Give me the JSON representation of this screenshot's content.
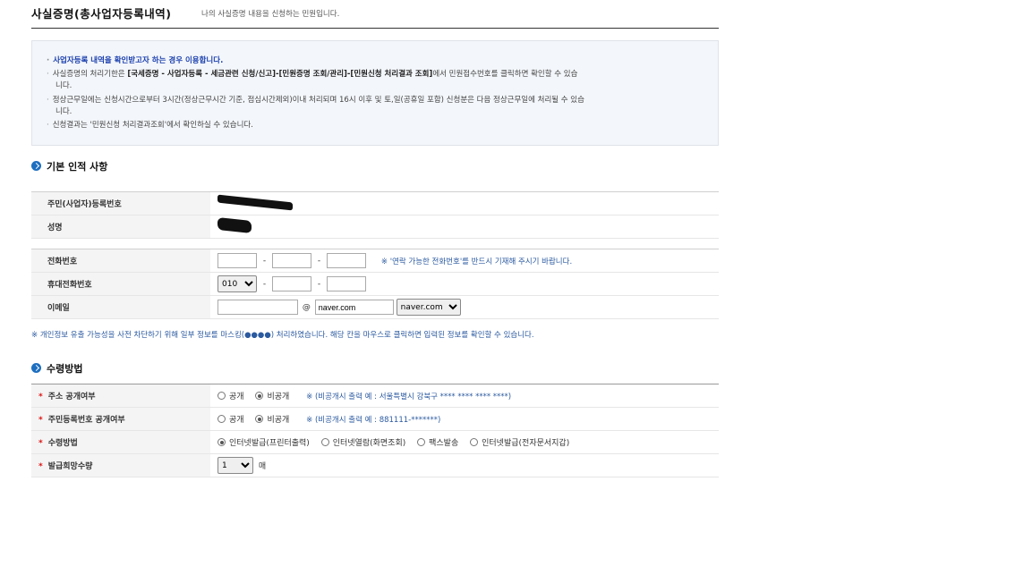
{
  "header": {
    "title": "사실증명(총사업자등록내역)",
    "subtitle": "나의 사실증명 내용을 신청하는 민원입니다."
  },
  "notice": {
    "line1": "사업자등록 내역을 확인받고자 하는 경우 이용합니다.",
    "line2_pre": "사실증명의 처리기한은 ",
    "line2_bold": "[국세증명 - 사업자등록 - 세금관련 신청/신고]-[민원증명 조회/관리]-[민원신청 처리결과 조회]",
    "line2_post": "에서 민원접수번호를 클릭하면 확인할 수 있습",
    "line2_wrap": "니다.",
    "line3": "정상근무일에는 신청시간으로부터 3시간(정상근무시간 기준, 점심시간제외)이내 처리되며 16시 이후 및 토,일(공휴일 포함) 신청분은 다음 정상근무일에 처리될 수 있습",
    "line3_wrap": "니다.",
    "line4": "신청결과는 '민원신청 처리결과조회'에서 확인하실 수 있습니다."
  },
  "basic": {
    "heading": "기본 인적 사항",
    "id_label": "주민(사업자)등록번호",
    "name_label": "성명"
  },
  "contact": {
    "phone_label": "전화번호",
    "phone_hint": "※ '연락 가능한 전화번호'를 반드시 기재해 주시기 바랍니다.",
    "mobile_label": "휴대전화번호",
    "mobile_prefix": "010",
    "email_label": "이메일",
    "email_at": "@",
    "email_domain": "naver.com",
    "email_domain_select": "naver.com"
  },
  "privacy_note": "※ 개인정보 유출 가능성을 사전 차단하기 위해 일부 정보를 마스킹(●●●●) 처리하였습니다. 해당 칸을 마우스로 클릭하면 입력된 정보를 확인할 수 있습니다.",
  "receive": {
    "heading": "수령방법",
    "required_mark": "*",
    "addr_label": "주소 공개여부",
    "addr_public": "공개",
    "addr_private": "비공개",
    "addr_hint": "※ (비공개시 출력 예 : 서울특별시 강북구 **** **** **** ****)",
    "rrn_label": "주민등록번호 공개여부",
    "rrn_public": "공개",
    "rrn_private": "비공개",
    "rrn_hint": "※ (비공개시 출력 예 : 881111-*******)",
    "method_label": "수령방법",
    "method_opt1": "인터넷발급(프린터출력)",
    "method_opt2": "인터넷열람(화면조회)",
    "method_opt3": "팩스발송",
    "method_opt4": "인터넷발급(전자문서지갑)",
    "copies_label": "발급희망수량",
    "copies_value": "1",
    "copies_unit": "매"
  }
}
